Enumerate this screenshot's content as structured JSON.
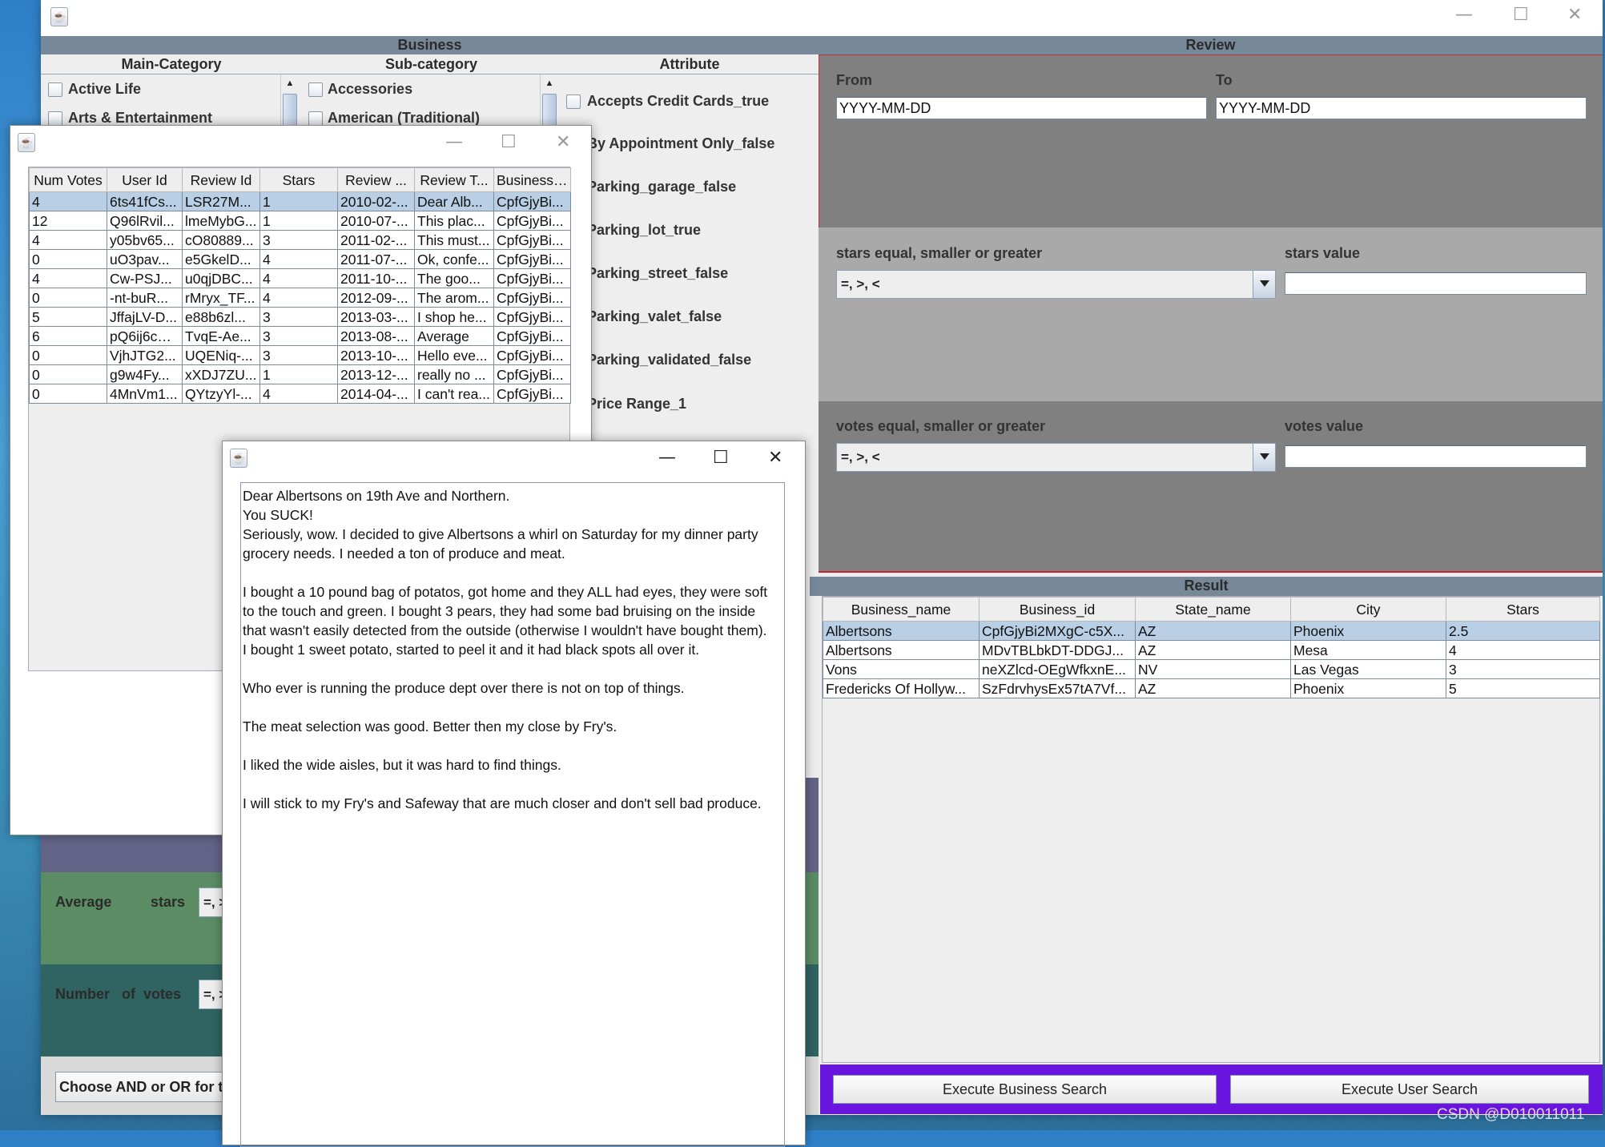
{
  "colors": {
    "header": "#778899",
    "review_dark": "#808080",
    "review_light": "#a9a9a9",
    "purple_bar": "#6a14e0",
    "selection": "#b8cfe5",
    "section_purple": "#636387",
    "section_green": "#5b8c64",
    "section_teal": "#2f6462"
  },
  "main_window": {
    "business_header": "Business",
    "review_header": "Review",
    "main_category": {
      "title": "Main-Category",
      "items": [
        "Active Life",
        "Arts & Entertainment"
      ]
    },
    "sub_category": {
      "title": "Sub-category",
      "items": [
        "Accessories",
        "American (Traditional)"
      ]
    },
    "attribute": {
      "title": "Attribute",
      "items": [
        "Accepts Credit Cards_true",
        "By Appointment Only_false",
        "Parking_garage_false",
        "Parking_lot_true",
        "Parking_street_false",
        "Parking_valet_false",
        "Parking_validated_false",
        "Price Range_1"
      ]
    },
    "business_filters": {
      "average_label": "Average",
      "stars_label": "stars",
      "avg_combo": "=, >, <",
      "votes_label": "Number   of  votes",
      "votes_combo": "=, >, <",
      "and_or_button": "Choose AND or OR for the"
    },
    "review": {
      "from_label": "From",
      "to_label": "To",
      "from_value": "YYYY-MM-DD",
      "to_value": "YYYY-MM-DD",
      "stars_cmp_label": "stars equal, smaller or greater",
      "stars_cmp_value": "=, >, <",
      "stars_value_label": "stars value",
      "stars_value": "",
      "votes_cmp_label": "votes equal, smaller or greater",
      "votes_cmp_value": "=, >, <",
      "votes_value_label": "votes value",
      "votes_value": ""
    },
    "result": {
      "header": "Result",
      "columns": [
        "Business_name",
        "Business_id",
        "State_name",
        "City",
        "Stars"
      ],
      "rows": [
        [
          "Albertsons",
          "CpfGjyBi2MXgC-c5X...",
          "AZ",
          "Phoenix",
          "2.5"
        ],
        [
          "Albertsons",
          "MDvTBLbkDT-DDGJ...",
          "AZ",
          "Mesa",
          "4"
        ],
        [
          "Vons",
          "neXZlcd-OEgWfkxnE...",
          "NV",
          "Las Vegas",
          "3"
        ],
        [
          "Fredericks Of Hollyw...",
          "SzFdrvhysEx57tA7Vf...",
          "AZ",
          "Phoenix",
          "5"
        ]
      ],
      "selected_row": 0
    },
    "buttons": {
      "business_search": "Execute Business Search",
      "user_search": "Execute User Search"
    }
  },
  "reviews_window": {
    "columns": [
      "Num Votes",
      "User Id",
      "Review Id",
      "Stars",
      "Review ...",
      "Review T...",
      "Business Id"
    ],
    "rows": [
      [
        "4",
        "6ts41fCs...",
        "LSR27M...",
        "1",
        "2010-02-...",
        "Dear Alb...",
        "CpfGjyBi..."
      ],
      [
        "12",
        "Q96lRvil...",
        "lmeMybG...",
        "1",
        "2010-07-...",
        "This plac...",
        "CpfGjyBi..."
      ],
      [
        "4",
        "y05bv65...",
        "cO80889...",
        "3",
        "2011-02-...",
        "This must...",
        "CpfGjyBi..."
      ],
      [
        "0",
        "uO3pav...",
        "e5GkelD...",
        "4",
        "2011-07-...",
        "Ok, confe...",
        "CpfGjyBi..."
      ],
      [
        "4",
        "Cw-PSJ...",
        "u0qjDBC...",
        "4",
        "2011-10-...",
        "The goo...",
        "CpfGjyBi..."
      ],
      [
        "0",
        "-nt-buR...",
        "rMryx_TF...",
        "4",
        "2012-09-...",
        "The arom...",
        "CpfGjyBi..."
      ],
      [
        "5",
        "JffajLV-D...",
        "e88b6zl...",
        "3",
        "2013-03-...",
        "I shop he...",
        "CpfGjyBi..."
      ],
      [
        "6",
        "pQ6ij6cO...",
        "TvqE-Ae...",
        "3",
        "2013-08-...",
        "Average",
        "CpfGjyBi..."
      ],
      [
        "0",
        "VjhJTG2...",
        "UQENiq-...",
        "3",
        "2013-10-...",
        "Hello eve...",
        "CpfGjyBi..."
      ],
      [
        "0",
        "g9w4Fy...",
        "xXDJ7ZU...",
        "1",
        "2013-12-...",
        "really no ...",
        "CpfGjyBi..."
      ],
      [
        "0",
        "4MnVm1...",
        "QYtzyYl-...",
        "4",
        "2014-04-...",
        "I can't rea...",
        "CpfGjyBi..."
      ]
    ],
    "selected_row": 0
  },
  "review_text_window": {
    "lines": [
      "Dear Albertsons on 19th Ave and Northern.",
      "You SUCK!",
      "Seriously, wow. I decided to give Albertsons a whirl on Saturday for my dinner party",
      "grocery needs. I needed a ton of produce and meat.",
      "",
      "I bought a 10 pound bag of potatos, got home and they ALL had eyes, they were soft",
      "to the touch and green. I bought 3 pears, they had some bad bruising on the inside",
      "that wasn't easily detected from the outside (otherwise I wouldn't have bought them).",
      "I bought 1 sweet potato, started to peel it and it had black spots all over it.",
      "",
      "Who ever is running the produce dept over there is not on top of things.",
      "",
      "The meat selection was good. Better then my close by Fry's.",
      "",
      "I liked the wide aisles, but it was hard to find things.",
      "",
      "I will stick to my Fry's and Safeway that are much closer and don't sell bad produce."
    ]
  },
  "watermark": "CSDN @D010011011"
}
